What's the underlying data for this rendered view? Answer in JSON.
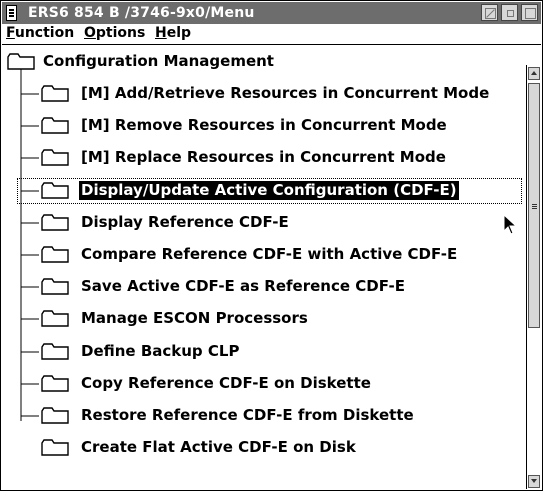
{
  "window": {
    "title": "ERS6 854 B  /3746-9x0/Menu"
  },
  "menubar": {
    "items": [
      "Function",
      "Options",
      "Help"
    ]
  },
  "tree": {
    "root": "Configuration Management",
    "items": [
      "[M] Add/Retrieve Resources in Concurrent Mode",
      "[M] Remove Resources in Concurrent Mode",
      "[M] Replace Resources in Concurrent Mode",
      "Display/Update Active Configuration (CDF-E)",
      "Display Reference CDF-E",
      "Compare Reference CDF-E with Active CDF-E",
      "Save Active CDF-E as Reference CDF-E",
      "Manage ESCON Processors",
      "Define Backup CLP",
      "Copy Reference CDF-E on Diskette",
      "Restore Reference CDF-E from Diskette",
      "Create Flat Active CDF-E on Disk"
    ],
    "selected_index": 3
  },
  "icons": {
    "system_menu": "system-menu-icon",
    "folder": "folder-icon",
    "minimize": "minimize-icon",
    "restore": "restore-icon",
    "maximize": "maximize-icon",
    "cursor": "mouse-pointer-icon"
  },
  "colors": {
    "titlebar": "#6d6d6d",
    "selection": "#000000",
    "background": "#ffffff"
  }
}
